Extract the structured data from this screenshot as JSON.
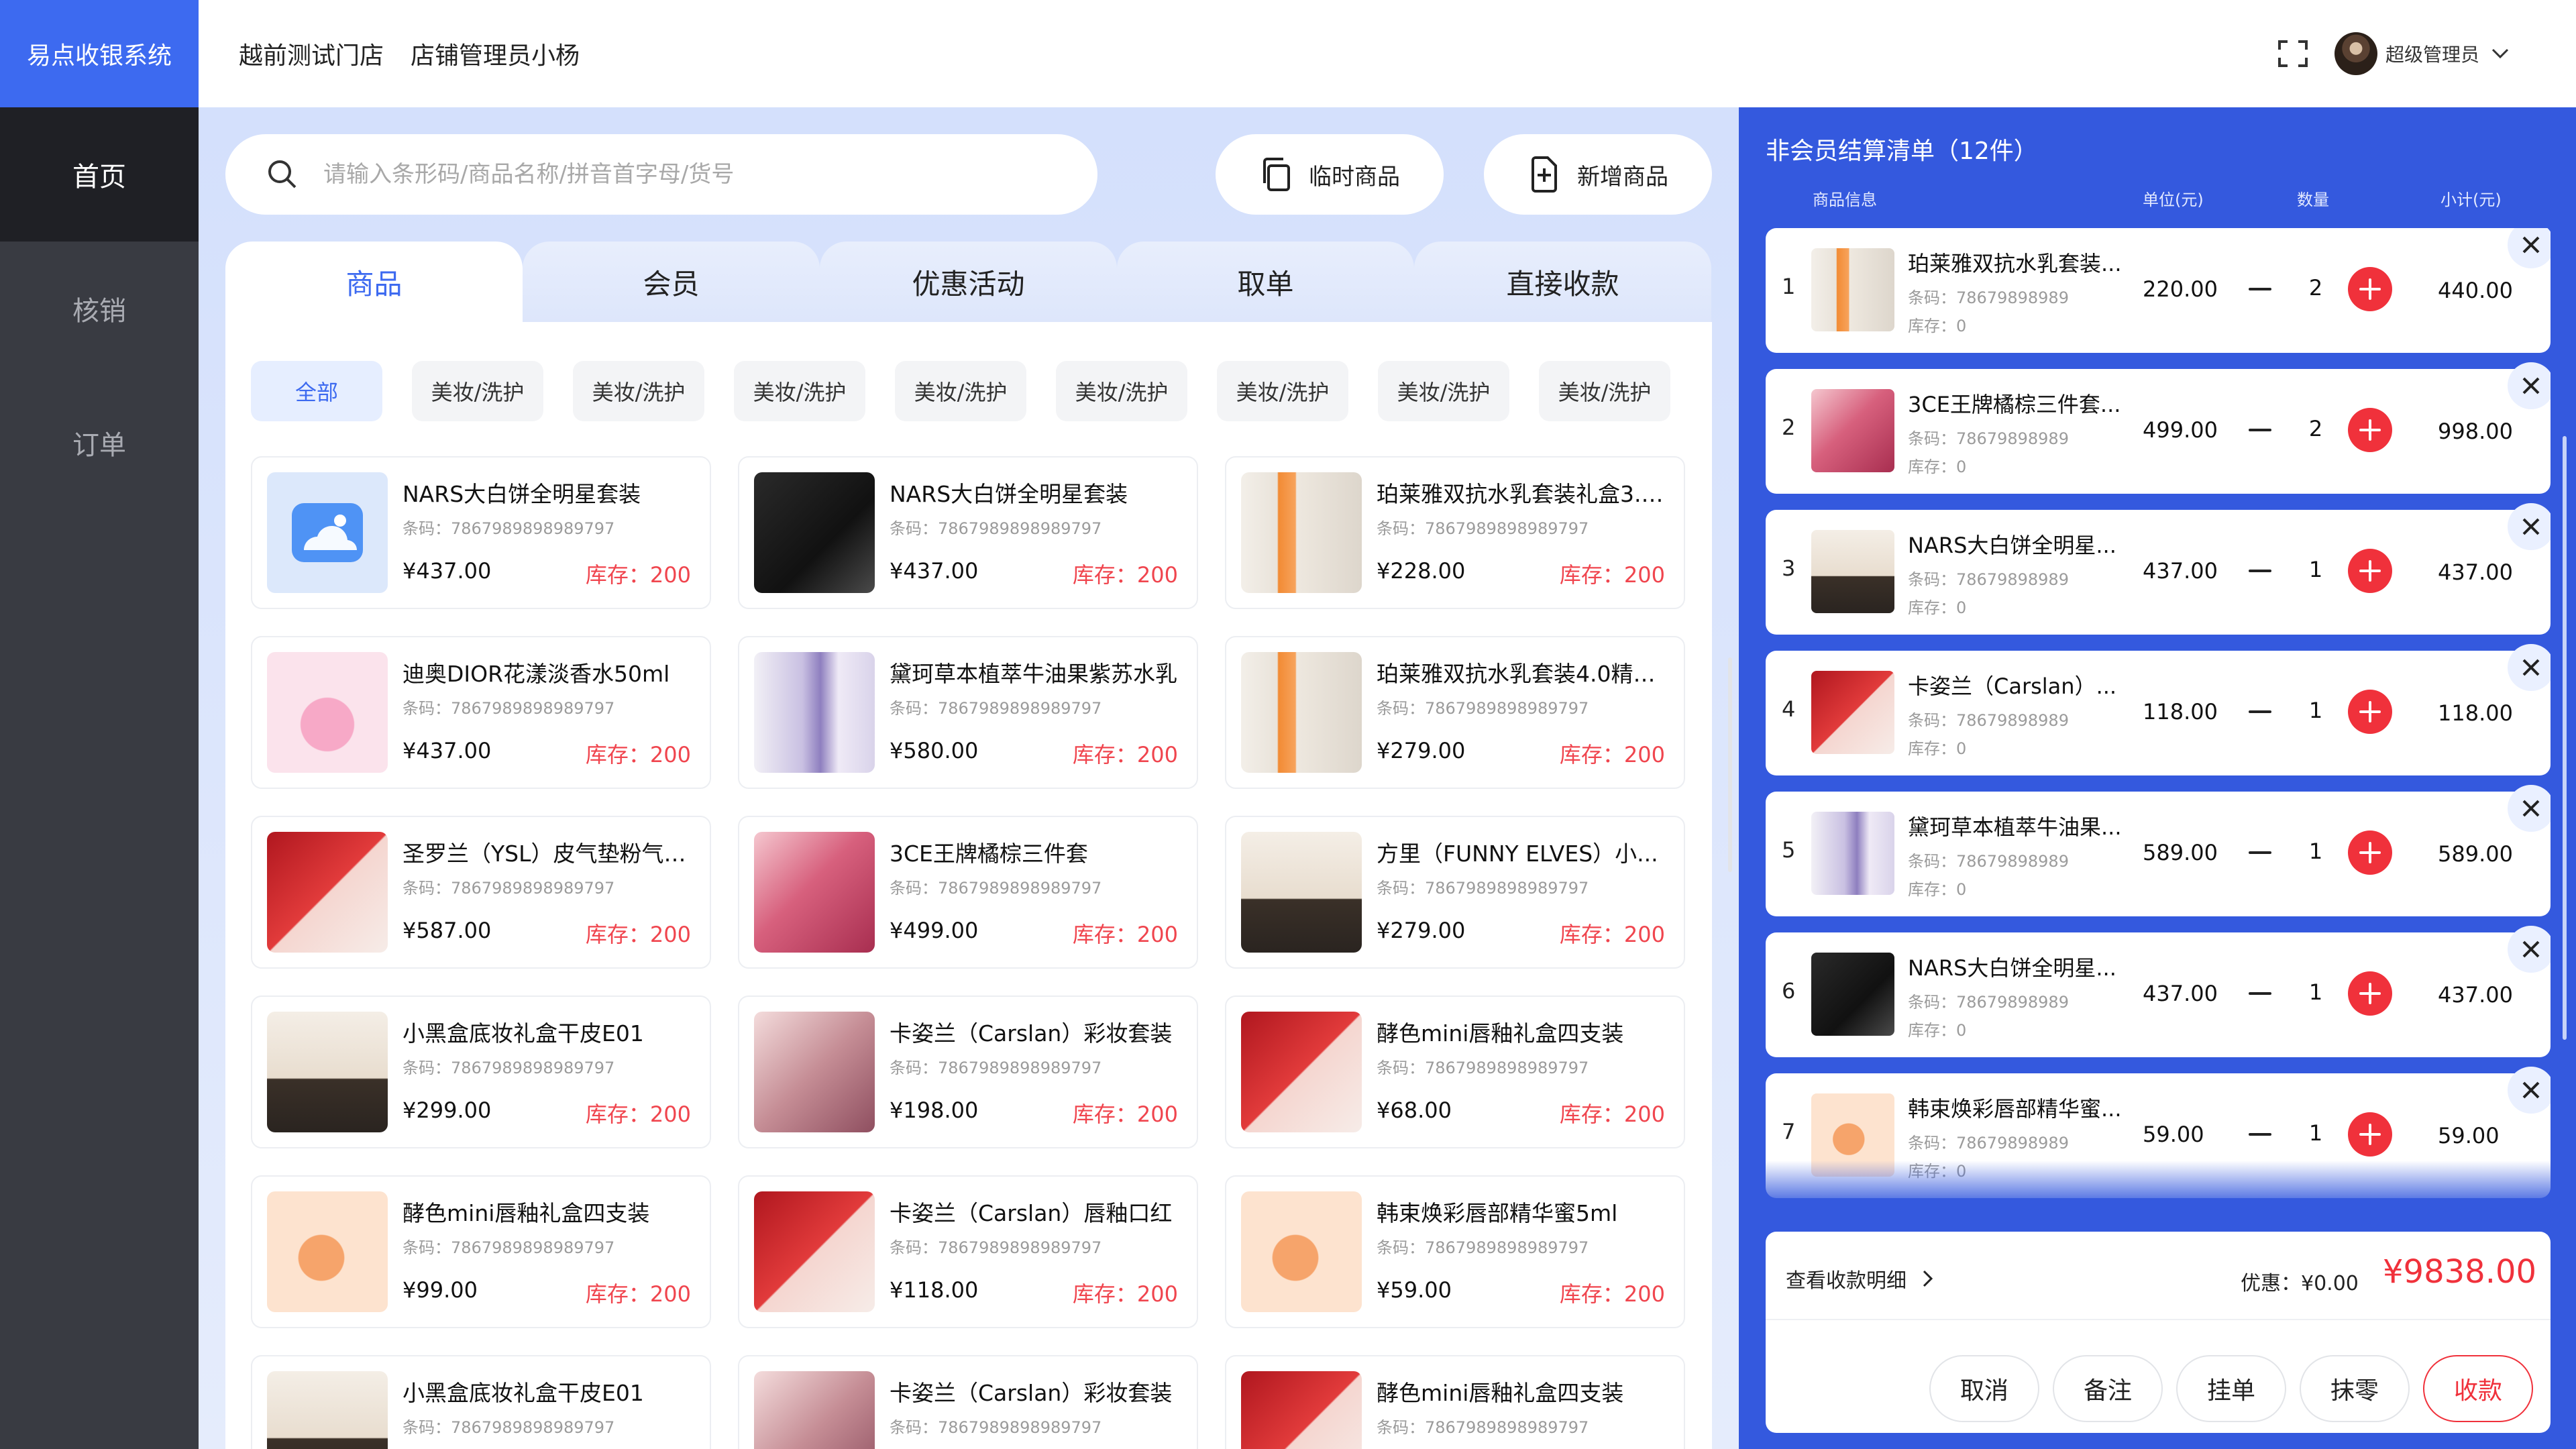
{
  "app": {
    "brand": "易点收银系统"
  },
  "sidebar": {
    "items": [
      {
        "label": "首页"
      },
      {
        "label": "核销"
      },
      {
        "label": "订单"
      }
    ]
  },
  "topbar": {
    "store": "越前测试门店",
    "manager": "店铺管理员小杨",
    "admin_name": "超级管理员"
  },
  "search": {
    "placeholder": "请输入条形码/商品名称/拼音首字母/货号",
    "value": ""
  },
  "actions": {
    "temp_label": "临时商品",
    "new_label": "新增商品"
  },
  "tabs": [
    {
      "label": "商品"
    },
    {
      "label": "会员"
    },
    {
      "label": "优惠活动"
    },
    {
      "label": "取单"
    },
    {
      "label": "直接收款"
    }
  ],
  "categories": [
    "全部",
    "美妆/洗护",
    "美妆/洗护",
    "美妆/洗护",
    "美妆/洗护",
    "美妆/洗护",
    "美妆/洗护",
    "美妆/洗护",
    "美妆/洗护"
  ],
  "products": [
    {
      "name": "NARS大白饼全明星套装",
      "code": "条码：7867989898989797",
      "price": "¥437.00",
      "stock": "库存：200",
      "thumb": "placeholder"
    },
    {
      "name": "NARS大白饼全明星套装",
      "code": "条码：7867989898989797",
      "price": "¥437.00",
      "stock": "库存：200",
      "thumb": "dark"
    },
    {
      "name": "珀莱雅双抗水乳套装礼盒3.0...",
      "code": "条码：7867989898989797",
      "price": "¥228.00",
      "stock": "库存：200",
      "thumb": "bottles-orange"
    },
    {
      "name": "迪奥DIOR花漾淡香水50ml",
      "code": "条码：7867989898989797",
      "price": "¥437.00",
      "stock": "库存：200",
      "thumb": "pink"
    },
    {
      "name": "黛珂草本植萃牛油果紫苏水乳",
      "code": "条码：7867989898989797",
      "price": "¥580.00",
      "stock": "库存：200",
      "thumb": "purple"
    },
    {
      "name": "珀莱雅双抗水乳套装4.0精华...",
      "code": "条码：7867989898989797",
      "price": "¥279.00",
      "stock": "库存：200",
      "thumb": "bottles-orange"
    },
    {
      "name": "圣罗兰（YSL）皮气垫粉气垫...",
      "code": "条码：7867989898989797",
      "price": "¥587.00",
      "stock": "库存：200",
      "thumb": "red"
    },
    {
      "name": "3CE王牌橘棕三件套",
      "code": "条码：7867989898989797",
      "price": "¥499.00",
      "stock": "库存：200",
      "thumb": "rose"
    },
    {
      "name": "方里（FUNNY ELVES）小...",
      "code": "条码：7867989898989797",
      "price": "¥279.00",
      "stock": "库存：200",
      "thumb": "beige"
    },
    {
      "name": "小黑盒底妆礼盒干皮E01",
      "code": "条码：7867989898989797",
      "price": "¥299.00",
      "stock": "库存：200",
      "thumb": "beige"
    },
    {
      "name": "卡姿兰（Carslan）彩妆套装",
      "code": "条码：7867989898989797",
      "price": "¥198.00",
      "stock": "库存：200",
      "thumb": "mauve"
    },
    {
      "name": "酵色mini唇釉礼盒四支装",
      "code": "条码：7867989898989797",
      "price": "¥68.00",
      "stock": "库存：200",
      "thumb": "red"
    },
    {
      "name": "酵色mini唇釉礼盒四支装",
      "code": "条码：7867989898989797",
      "price": "¥99.00",
      "stock": "库存：200",
      "thumb": "peach"
    },
    {
      "name": "卡姿兰（Carslan）唇釉口红",
      "code": "条码：7867989898989797",
      "price": "¥118.00",
      "stock": "库存：200",
      "thumb": "red"
    },
    {
      "name": "韩束焕彩唇部精华蜜5ml",
      "code": "条码：7867989898989797",
      "price": "¥59.00",
      "stock": "库存：200",
      "thumb": "peach"
    },
    {
      "name": "小黑盒底妆礼盒干皮E01",
      "code": "条码：7867989898989797",
      "price": "",
      "stock": "",
      "thumb": "beige"
    },
    {
      "name": "卡姿兰（Carslan）彩妆套装",
      "code": "条码：7867989898989797",
      "price": "",
      "stock": "",
      "thumb": "mauve"
    },
    {
      "name": "酵色mini唇釉礼盒四支装",
      "code": "条码：7867989898989797",
      "price": "",
      "stock": "",
      "thumb": "red"
    }
  ],
  "cart": {
    "title": "非会员结算清单（12件）",
    "headers": {
      "info": "商品信息",
      "unit": "单位(元)",
      "qty": "数量",
      "subtotal": "小计(元)"
    },
    "items": [
      {
        "idx": "1",
        "name": "珀莱雅双抗水乳套装...",
        "code": "条码：78679898989",
        "stock": "库存：0",
        "price": "220.00",
        "qty": "2",
        "subtotal": "440.00",
        "thumb": "bottles-orange"
      },
      {
        "idx": "2",
        "name": "3CE王牌橘棕三件套...",
        "code": "条码：78679898989",
        "stock": "库存：0",
        "price": "499.00",
        "qty": "2",
        "subtotal": "998.00",
        "thumb": "rose"
      },
      {
        "idx": "3",
        "name": "NARS大白饼全明星...",
        "code": "条码：78679898989",
        "stock": "库存：0",
        "price": "437.00",
        "qty": "1",
        "subtotal": "437.00",
        "thumb": "beige"
      },
      {
        "idx": "4",
        "name": "卡姿兰（Carslan）...",
        "code": "条码：78679898989",
        "stock": "库存：0",
        "price": "118.00",
        "qty": "1",
        "subtotal": "118.00",
        "thumb": "red"
      },
      {
        "idx": "5",
        "name": "黛珂草本植萃牛油果...",
        "code": "条码：78679898989",
        "stock": "库存：0",
        "price": "589.00",
        "qty": "1",
        "subtotal": "589.00",
        "thumb": "purple"
      },
      {
        "idx": "6",
        "name": "NARS大白饼全明星...",
        "code": "条码：78679898989",
        "stock": "库存：0",
        "price": "437.00",
        "qty": "1",
        "subtotal": "437.00",
        "thumb": "dark"
      },
      {
        "idx": "7",
        "name": "韩束焕彩唇部精华蜜...",
        "code": "条码：78679898989",
        "stock": "库存：0",
        "price": "59.00",
        "qty": "1",
        "subtotal": "59.00",
        "thumb": "peach"
      }
    ],
    "detail_label": "查看收款明细",
    "discount": "优惠：¥0.00",
    "total": "¥9838.00",
    "buttons": [
      {
        "label": "取消"
      },
      {
        "label": "备注"
      },
      {
        "label": "挂单"
      },
      {
        "label": "抹零"
      },
      {
        "label": "收款"
      }
    ]
  },
  "colors": {
    "accent": "#3d6af0",
    "cart_panel": "#3459de",
    "danger": "#f0313b",
    "sidebar": "#393b42"
  }
}
